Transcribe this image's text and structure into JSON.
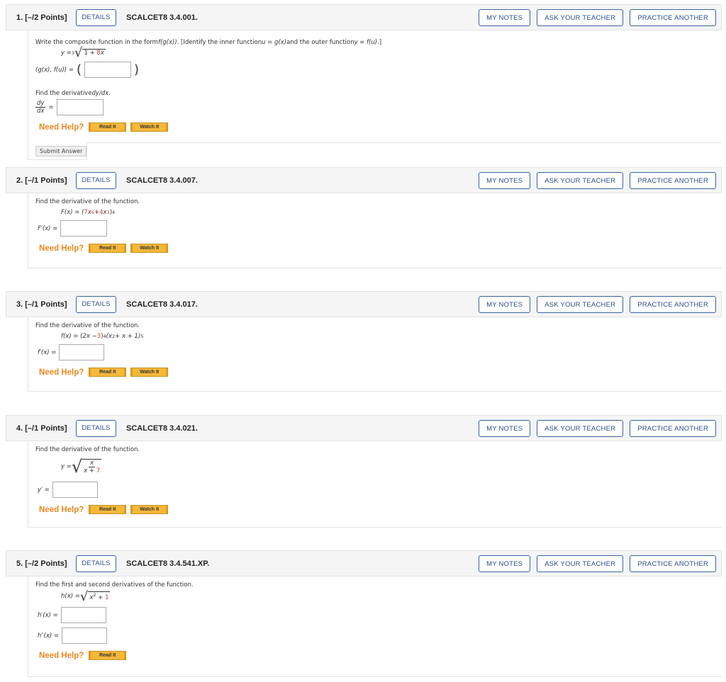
{
  "common": {
    "details": "DETAILS",
    "my_notes": "MY NOTES",
    "ask": "ASK YOUR TEACHER",
    "practice": "PRACTICE ANOTHER",
    "need_help": "Need Help?",
    "read_it": "Read It",
    "watch_it": "Watch It",
    "submit": "Submit Answer"
  },
  "q1": {
    "num": "1.",
    "points": "[–/2 Points]",
    "code": "SCALCET8 3.4.001.",
    "prompt_a": "Write the composite function in the form ",
    "prompt_fg": "f(g(x))",
    "prompt_b": ". [Identify the inner function ",
    "prompt_u": "u = g(x)",
    "prompt_c": " and the outer function ",
    "prompt_y": "y = f(u)",
    "prompt_d": ".]",
    "eq_lhs": "y = ",
    "eq_index": "3",
    "eq_rad_a": "1 + ",
    "eq_rad_red": "8",
    "eq_rad_b": "x",
    "ans1_label": "(g(x), f(u)) = ",
    "find": "Find the derivative ",
    "find_m": "dy/dx",
    "find_end": ".",
    "dy": "dy",
    "dx": "dx",
    "eq": "="
  },
  "q2": {
    "num": "2.",
    "points": "[–/1 Points]",
    "code": "SCALCET8 3.4.007.",
    "prompt": "Find the derivative of the function.",
    "f_a": "F(x) = (",
    "f_red1": "7",
    "f_b": "x",
    "f_exp1": "6",
    "f_c": " + ",
    "f_red2": "4",
    "f_d": "x",
    "f_exp2": "3",
    "f_e": ")",
    "f_exp3": "4",
    "ans": "F′(x) ="
  },
  "q3": {
    "num": "3.",
    "points": "[–/1 Points]",
    "code": "SCALCET8 3.4.017.",
    "prompt": "Find the derivative of the function.",
    "f_a": "f(x) = (2x − ",
    "f_red": "3",
    "f_b": ")",
    "f_exp1": "4",
    "f_c": "(x",
    "f_exp2": "2",
    "f_d": " + x + 1)",
    "f_exp3": "5",
    "ans": "f′(x) ="
  },
  "q4": {
    "num": "4.",
    "points": "[–/1 Points]",
    "code": "SCALCET8 3.4.021.",
    "prompt": "Find the derivative of the function.",
    "f_lhs": "y = ",
    "f_num": "x",
    "f_den_a": "x + ",
    "f_den_red": "7",
    "ans": "y′ ="
  },
  "q5": {
    "num": "5.",
    "points": "[–/2 Points]",
    "code": "SCALCET8 3.4.541.XP.",
    "prompt": "Find the first and second derivatives of the function.",
    "f_lhs": "h(x) = ",
    "f_a": "x",
    "f_exp": "2",
    "f_b": " + ",
    "f_red": "1",
    "ans1": "h′(x) =",
    "ans2": "h″(x) ="
  }
}
